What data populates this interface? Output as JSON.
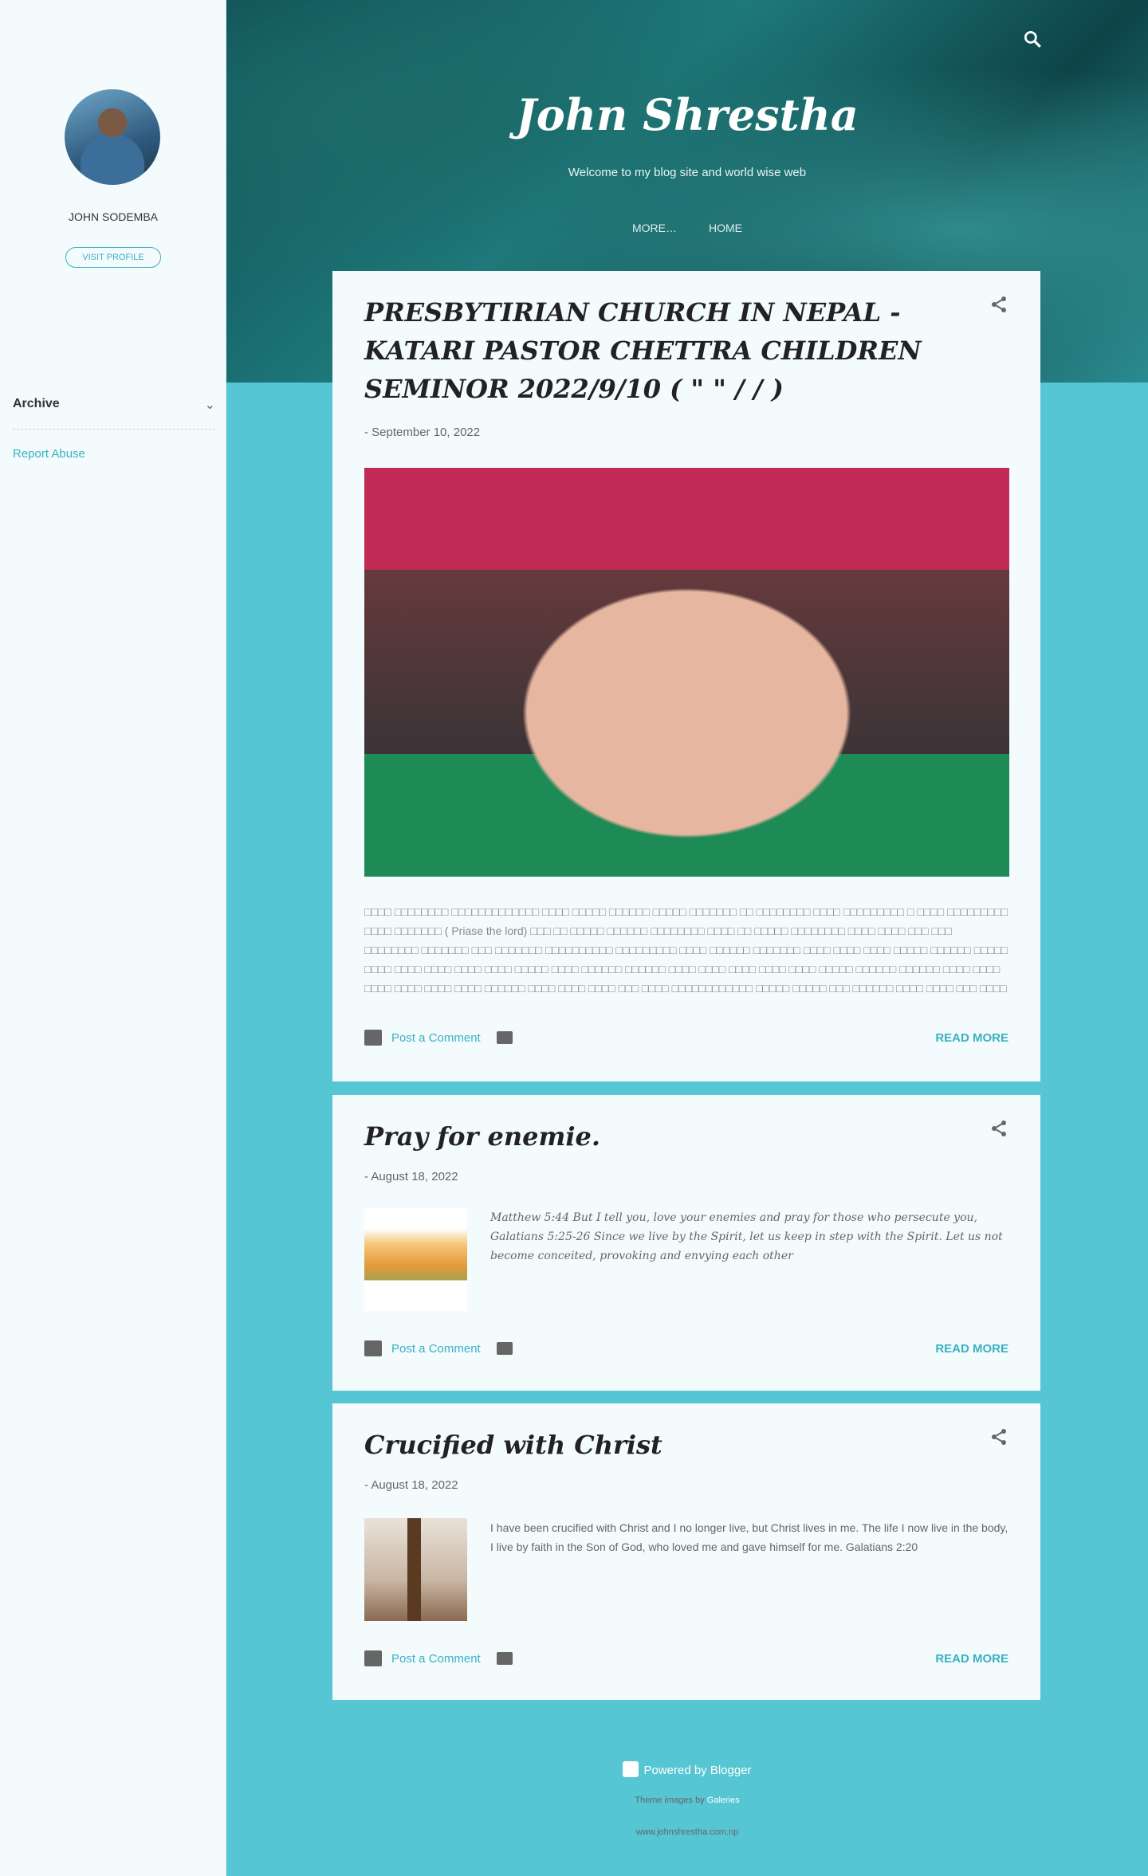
{
  "sidebar": {
    "profile_name": "JOHN SODEMBA",
    "visit_label": "VISIT PROFILE",
    "archive_label": "Archive",
    "report_label": "Report Abuse"
  },
  "header": {
    "title": "John Shrestha",
    "tagline": "Welcome to my blog site and world wise web",
    "nav": [
      "MORE…",
      "HOME"
    ]
  },
  "posts": [
    {
      "title": "PRESBYTIRIAN CHURCH  IN NEPAL - KATARI PASTOR CHETTRA CHILDREN SEMINOR 2022/9/10 (            \"             \"          / /  )",
      "date": "- September 10, 2022",
      "snippet": "□□□□ □□□□□□□□ □□□□□□□□□□□□□ □□□□ □□□□□ □□□□□□ □□□□□ □□□□□□□ □□ □□□□□□□□ □□□□ □□□□□□□□□ □ □□□□ □□□□□□□□□ □□□□ □□□□□□□ ( Priase the lord) □□□ □□ □□□□□ □□□□□□ □□□□□□□□ □□□□ □□ □□□□□ □□□□□□□□ □□□□ □□□□ □□□ □□□ □□□□□□□□ □□□□□□□ □□□ □□□□□□□ □□□□□□□□□□ □□□□□□□□□ □□□□ □□□□□□ □□□□□□□ □□□□ □□□□ □□□□ □□□□□ □□□□□□ □□□□□ □□□□ □□□□ □□□□ □□□□ □□□□ □□□□□ □□□□ □□□□□□ □□□□□□ □□□□ □□□□ □□□□ □□□□ □□□□ □□□□□ □□□□□□ □□□□□□ □□□□ □□□□ □□□□ □□□□ □□□□ □□□□ □□□□□□ □□□□ □□□□ □□□□ □□□ □□□□ □□□□□□□□□□□□ □□□□□ □□□□□ □□□ □□□□□□ □□□□ □□□□ □□□ □□□□ □□□□□□□□□□□□ □□□□□□ □□□□□ □□□□□□ □□□□ □□□□ □□□ □□□□ □□□□□□□□□□□ …",
      "comment": "Post a Comment",
      "read_more": "READ MORE"
    },
    {
      "title": "Pray for enemie.",
      "date": "- August 18, 2022",
      "snippet": "Matthew 5:44  But I tell you, love your enemies and pray for those who persecute you, Galatians 5:25-26   Since we live by the Spirit, let us keep in step with the Spirit.  Let us not become conceited, provoking and envying each other",
      "comment": "Post a Comment",
      "read_more": "READ MORE"
    },
    {
      "title": "Crucified with Christ",
      "date": "- August 18, 2022",
      "snippet": "I have been crucified with Christ and I no longer live, but Christ lives in me. The life I now live in the body, I live by faith in the Son of God, who loved me and gave himself for me. Galatians 2:20",
      "comment": "Post a Comment",
      "read_more": "READ MORE"
    }
  ],
  "footer": {
    "powered": "Powered by Blogger",
    "theme_prefix": "Theme images by",
    "theme_link": "Galeries",
    "site": "www.johnshrestha.com.np"
  },
  "colors": {
    "accent": "#3ab0c3",
    "background": "#56c5d4",
    "card": "#f3fbfd"
  }
}
